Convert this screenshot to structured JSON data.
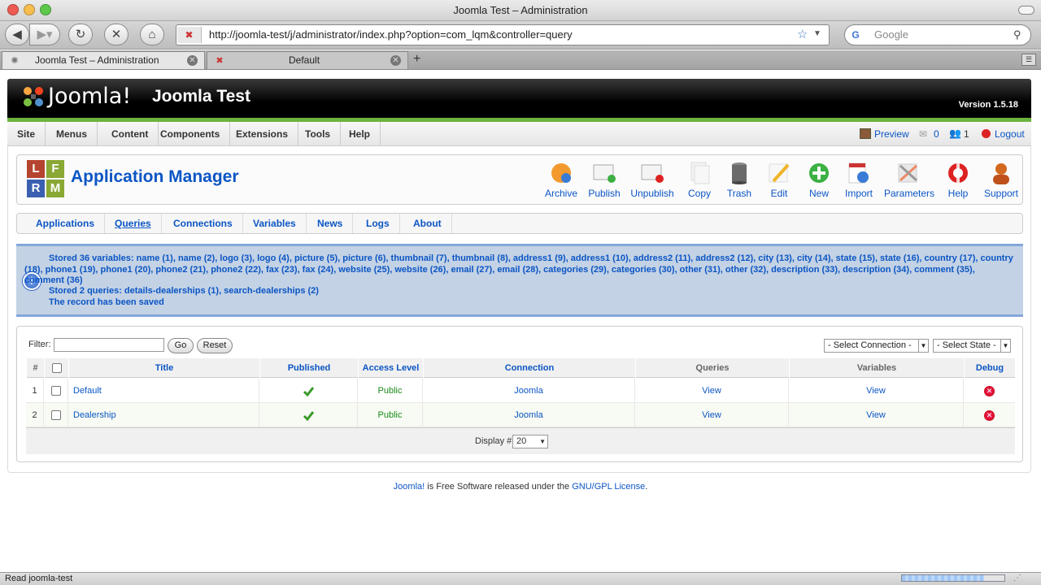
{
  "browser": {
    "window_title": "Joomla Test – Administration",
    "url": "http://joomla-test/j/administrator/index.php?option=com_lqm&controller=query",
    "search_placeholder": "Google",
    "tabs": [
      {
        "label": "Joomla Test – Administration"
      },
      {
        "label": "Default"
      }
    ],
    "status_text": "Read joomla-test"
  },
  "header": {
    "logo_text": "Joomla!",
    "site_name": "Joomla Test",
    "version": "Version 1.5.18"
  },
  "menu": {
    "items": [
      "Site",
      "Menus",
      "Content",
      "Components",
      "Extensions",
      "Tools",
      "Help"
    ],
    "preview": "Preview",
    "messages_count": "0",
    "users_count": "1",
    "logout": "Logout"
  },
  "toolbar": {
    "logo_letters": [
      "L",
      "F",
      "R",
      "M"
    ],
    "title": "Application Manager",
    "buttons": [
      "Archive",
      "Publish",
      "Unpublish",
      "Copy",
      "Trash",
      "Edit",
      "New",
      "Import",
      "Parameters",
      "Help",
      "Support"
    ]
  },
  "subnav": {
    "items": [
      "Applications",
      "Queries",
      "Connections",
      "Variables",
      "News",
      "Logs",
      "About"
    ]
  },
  "message": {
    "line1": "Stored 36 variables: name (1), name (2), logo (3), logo (4), picture (5), picture (6), thumbnail (7), thumbnail (8), address1 (9), address1 (10), address2 (11), address2 (12), city (13), city (14), state (15), state (16), country (17), country",
    "line2": "(18), phone1 (19), phone1 (20), phone2 (21), phone2 (22), fax (23), fax (24), website (25), website (26), email (27), email (28), categories (29), categories (30), other (31), other (32), description (33), description (34), comment (35),",
    "line3": "comment (36)",
    "line4": "Stored 2 queries: details-dealerships (1), search-dealerships (2)",
    "line5": "The record has been saved"
  },
  "filter": {
    "label": "Filter:",
    "value": "",
    "go": "Go",
    "reset": "Reset",
    "select_connection": "- Select Connection -",
    "select_state": "- Select State -"
  },
  "table": {
    "headers": [
      "#",
      "Title",
      "Published",
      "Access Level",
      "Connection",
      "Queries",
      "Variables",
      "Debug"
    ],
    "rows": [
      {
        "num": "1",
        "title": "Default",
        "access": "Public",
        "connection": "Joomla",
        "queries": "View",
        "variables": "View"
      },
      {
        "num": "2",
        "title": "Dealership",
        "access": "Public",
        "connection": "Joomla",
        "queries": "View",
        "variables": "View"
      }
    ],
    "display_label": "Display #",
    "display_value": "20"
  },
  "footer": {
    "joomla": "Joomla!",
    "text": " is Free Software released under the ",
    "license": "GNU/GPL License",
    "end": "."
  },
  "colors": {
    "link": "#0b55c4",
    "header_green": "#6cb33e",
    "message_bg": "#c3d2e5"
  }
}
